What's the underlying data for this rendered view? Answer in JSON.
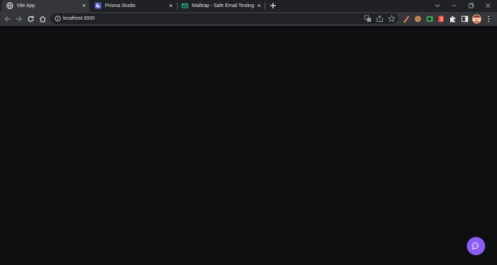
{
  "tabs": [
    {
      "title": "Vite App",
      "icon": "globe-icon",
      "active": true
    },
    {
      "title": "Prisma Studio",
      "icon": "prisma-icon",
      "active": false
    },
    {
      "title": "Mailtrap - Safe Email Testing",
      "icon": "mailtrap-icon",
      "active": false
    }
  ],
  "close_glyph": "×",
  "address_bar": {
    "url": "localhost:3000"
  },
  "toolbar_icons": [
    "back-icon",
    "forward-icon",
    "reload-icon",
    "home-icon",
    "info-icon",
    "translate-icon",
    "share-icon",
    "bookmark-star-icon",
    "extension-pen-icon",
    "extension-cookie-icon",
    "extension-green-icon",
    "extension-red-icon",
    "extensions-puzzle-icon",
    "side-panel-icon",
    "profile-avatar",
    "menu-icon"
  ],
  "colors": {
    "tab_strip": "#202124",
    "toolbar": "#35363a",
    "page_background": "#0e0f10",
    "chat_button": "#8b5cf6"
  }
}
